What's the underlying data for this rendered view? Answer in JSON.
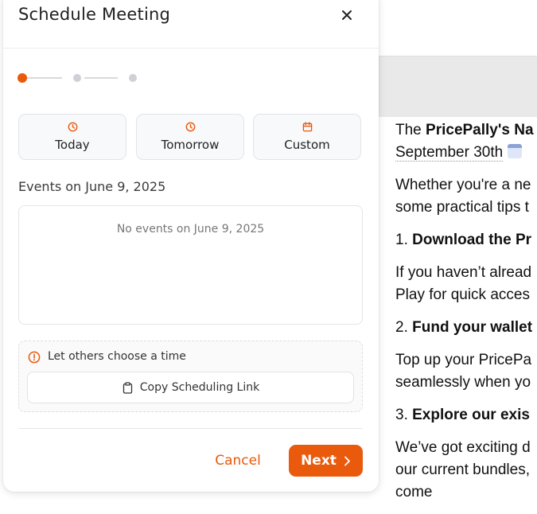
{
  "modal": {
    "title": "Schedule Meeting",
    "steps": {
      "total": 3,
      "current": 1
    },
    "options": [
      {
        "label": "Today",
        "icon": "clock-icon"
      },
      {
        "label": "Tomorrow",
        "icon": "clock-icon"
      },
      {
        "label": "Custom",
        "icon": "calendar-icon"
      }
    ],
    "events_heading": "Events on June 9, 2025",
    "events_empty": "No events on June 9, 2025",
    "others": {
      "label": "Let others choose a time",
      "copy_link": "Copy Scheduling Link"
    },
    "footer": {
      "cancel": "Cancel",
      "next": "Next"
    }
  },
  "article": {
    "p1_prefix": "The ",
    "p1_bold": "PricePally's Na",
    "p1_line2": "September 30th",
    "p2_l1": "Whether you're a ne",
    "p2_l2": "some practical tips t",
    "h1_num": "1. ",
    "h1_bold": "Download the Pr",
    "p3_l1": "If you haven’t alread",
    "p3_l2": "Play for quick acces",
    "h2_num": "2. ",
    "h2_bold": "Fund your wallet",
    "p4_l1": "Top up your PricePa",
    "p4_l2": "seamlessly when yo",
    "h3_num": "3. ",
    "h3_bold": "Explore our exis",
    "p5_l1": "We’ve got exciting d",
    "p5_l2": "our current bundles,",
    "p5_l3": "come"
  },
  "colors": {
    "accent": "#ea5a0c",
    "step_inactive": "#d0d0d6",
    "border": "#e2e4ea"
  }
}
